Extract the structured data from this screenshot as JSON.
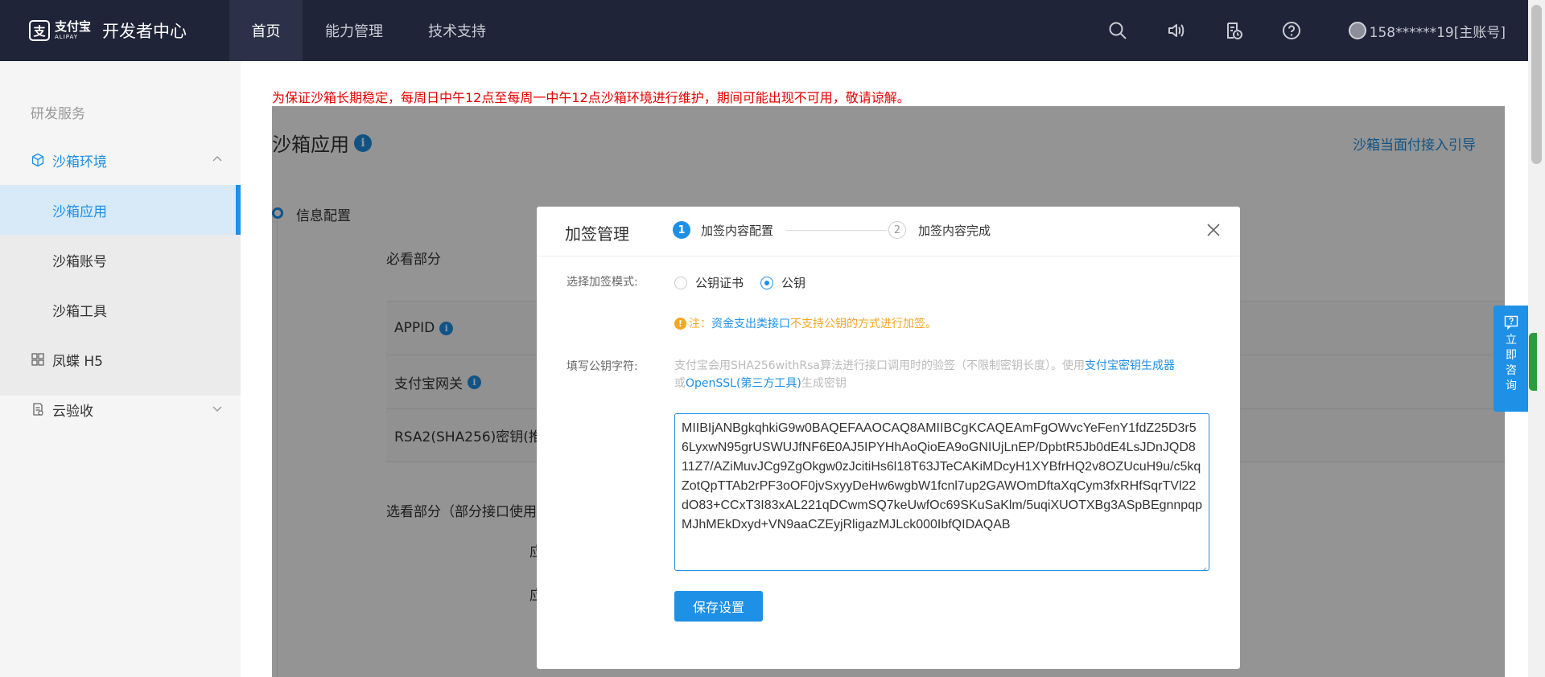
{
  "header": {
    "logo_cn": "支付宝",
    "logo_en": "ALIPAY",
    "logo_glyph": "支",
    "product": "开发者中心",
    "nav": [
      {
        "label": "首页",
        "active": true
      },
      {
        "label": "能力管理",
        "active": false
      },
      {
        "label": "技术支持",
        "active": false
      }
    ],
    "icons": [
      "search-icon",
      "speaker-icon",
      "document-clock-icon",
      "help-icon"
    ],
    "user": "158******19[主账号]"
  },
  "sidebar": {
    "section_title": "研发服务",
    "items": [
      {
        "label": "沙箱环境",
        "icon": "cube-icon",
        "expanded": true
      },
      {
        "label": "沙箱应用",
        "active": true
      },
      {
        "label": "沙箱账号"
      },
      {
        "label": "沙箱工具"
      },
      {
        "label": "凤蝶 H5",
        "icon": "grid-icon"
      },
      {
        "label": "云验收",
        "icon": "clipboard-icon"
      }
    ]
  },
  "notice": "为保证沙箱长期稳定，每周日中午12点至每周一中午12点沙箱环境进行维护，期间可能出现不可用，敬请谅解。",
  "page": {
    "title": "沙箱应用",
    "info_glyph": "i",
    "guide_link": "沙箱当面付接入引导",
    "step_label": "信息配置",
    "required_title": "必看部分",
    "rows": [
      {
        "label": "APPID"
      },
      {
        "label": "支付宝网关"
      },
      {
        "label": "RSA2(SHA256)密钥(推"
      }
    ],
    "optional_title": "选看部分（部分接口使用",
    "opt_a": "应",
    "opt_b": "应"
  },
  "modal": {
    "title": "加签管理",
    "step1_num": "1",
    "step1_label": "加签内容配置",
    "step2_num": "2",
    "step2_label": "加签内容完成",
    "mode_label": "选择加签模式:",
    "mode_options": [
      {
        "label": "公钥证书",
        "checked": false
      },
      {
        "label": "公钥",
        "checked": true
      }
    ],
    "warn_icon": "!",
    "warn_prefix": "注：",
    "warn_link": "资金支出类接口",
    "warn_suffix": "不支持公钥的方式进行加签。",
    "key_label": "填写公钥字符:",
    "help_text_1": "支付宝会用SHA256withRsa算法进行接口调用时的验签（不限制密钥长度）。使用",
    "help_link_1": "支付宝密钥生成器",
    "help_text_2": "或",
    "help_link_2": "OpenSSL(第三方工具)",
    "help_text_3": "生成密钥",
    "key_value": "MIIBIjANBgkqhkiG9w0BAQEFAAOCAQ8AMIIBCgKCAQEAmFgOWvcYeFenY1fdZ25D3r56LyxwN95grUSWUJfNF6E0AJ5IPYHhAoQioEA9oGNIUjLnEP/DpbtR5Jb0dE4LsJDnJQD811Z7/AZiMuvJCg9ZgOkgw0zJcitiHs6l18T63JTeCAKiMDcyH1XYBfrHQ2v8OZUcuH9u/c5kqZotQpTTAb2rPF3oOF0jvSxyyDeHw6wgbW1fcnl7up2GAWOmDftaXqCym3fxRHfSqrTVl22dO83+CCxT3I83xAL221qDCwmSQ7keUwfOc69SKuSaKlm/5uqiXUOTXBg3ASpBEgnnpqpMJhMEkDxyd+VN9aaCZEyjRligazMJLck000IbfQIDAQAB",
    "save_label": "保存设置"
  },
  "float": {
    "label": "立即咨询",
    "chars": [
      "立",
      "即",
      "咨",
      "询"
    ]
  },
  "colors": {
    "nav_bg": "#1f2438",
    "accent": "#1e90e6",
    "warning": "#f5a623",
    "notice": "#e60000"
  }
}
